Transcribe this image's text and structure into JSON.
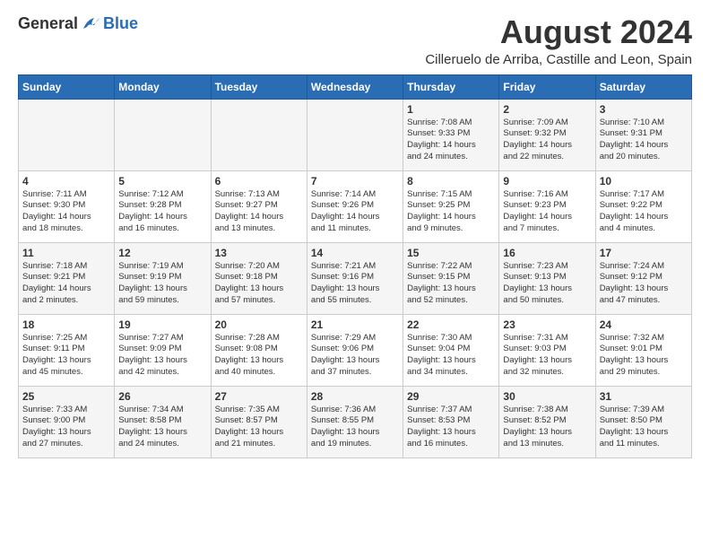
{
  "header": {
    "logo_general": "General",
    "logo_blue": "Blue",
    "month_title": "August 2024",
    "subtitle": "Cilleruelo de Arriba, Castille and Leon, Spain"
  },
  "weekdays": [
    "Sunday",
    "Monday",
    "Tuesday",
    "Wednesday",
    "Thursday",
    "Friday",
    "Saturday"
  ],
  "weeks": [
    [
      {
        "day": "",
        "info": ""
      },
      {
        "day": "",
        "info": ""
      },
      {
        "day": "",
        "info": ""
      },
      {
        "day": "",
        "info": ""
      },
      {
        "day": "1",
        "info": "Sunrise: 7:08 AM\nSunset: 9:33 PM\nDaylight: 14 hours\nand 24 minutes."
      },
      {
        "day": "2",
        "info": "Sunrise: 7:09 AM\nSunset: 9:32 PM\nDaylight: 14 hours\nand 22 minutes."
      },
      {
        "day": "3",
        "info": "Sunrise: 7:10 AM\nSunset: 9:31 PM\nDaylight: 14 hours\nand 20 minutes."
      }
    ],
    [
      {
        "day": "4",
        "info": "Sunrise: 7:11 AM\nSunset: 9:30 PM\nDaylight: 14 hours\nand 18 minutes."
      },
      {
        "day": "5",
        "info": "Sunrise: 7:12 AM\nSunset: 9:28 PM\nDaylight: 14 hours\nand 16 minutes."
      },
      {
        "day": "6",
        "info": "Sunrise: 7:13 AM\nSunset: 9:27 PM\nDaylight: 14 hours\nand 13 minutes."
      },
      {
        "day": "7",
        "info": "Sunrise: 7:14 AM\nSunset: 9:26 PM\nDaylight: 14 hours\nand 11 minutes."
      },
      {
        "day": "8",
        "info": "Sunrise: 7:15 AM\nSunset: 9:25 PM\nDaylight: 14 hours\nand 9 minutes."
      },
      {
        "day": "9",
        "info": "Sunrise: 7:16 AM\nSunset: 9:23 PM\nDaylight: 14 hours\nand 7 minutes."
      },
      {
        "day": "10",
        "info": "Sunrise: 7:17 AM\nSunset: 9:22 PM\nDaylight: 14 hours\nand 4 minutes."
      }
    ],
    [
      {
        "day": "11",
        "info": "Sunrise: 7:18 AM\nSunset: 9:21 PM\nDaylight: 14 hours\nand 2 minutes."
      },
      {
        "day": "12",
        "info": "Sunrise: 7:19 AM\nSunset: 9:19 PM\nDaylight: 13 hours\nand 59 minutes."
      },
      {
        "day": "13",
        "info": "Sunrise: 7:20 AM\nSunset: 9:18 PM\nDaylight: 13 hours\nand 57 minutes."
      },
      {
        "day": "14",
        "info": "Sunrise: 7:21 AM\nSunset: 9:16 PM\nDaylight: 13 hours\nand 55 minutes."
      },
      {
        "day": "15",
        "info": "Sunrise: 7:22 AM\nSunset: 9:15 PM\nDaylight: 13 hours\nand 52 minutes."
      },
      {
        "day": "16",
        "info": "Sunrise: 7:23 AM\nSunset: 9:13 PM\nDaylight: 13 hours\nand 50 minutes."
      },
      {
        "day": "17",
        "info": "Sunrise: 7:24 AM\nSunset: 9:12 PM\nDaylight: 13 hours\nand 47 minutes."
      }
    ],
    [
      {
        "day": "18",
        "info": "Sunrise: 7:25 AM\nSunset: 9:11 PM\nDaylight: 13 hours\nand 45 minutes."
      },
      {
        "day": "19",
        "info": "Sunrise: 7:27 AM\nSunset: 9:09 PM\nDaylight: 13 hours\nand 42 minutes."
      },
      {
        "day": "20",
        "info": "Sunrise: 7:28 AM\nSunset: 9:08 PM\nDaylight: 13 hours\nand 40 minutes."
      },
      {
        "day": "21",
        "info": "Sunrise: 7:29 AM\nSunset: 9:06 PM\nDaylight: 13 hours\nand 37 minutes."
      },
      {
        "day": "22",
        "info": "Sunrise: 7:30 AM\nSunset: 9:04 PM\nDaylight: 13 hours\nand 34 minutes."
      },
      {
        "day": "23",
        "info": "Sunrise: 7:31 AM\nSunset: 9:03 PM\nDaylight: 13 hours\nand 32 minutes."
      },
      {
        "day": "24",
        "info": "Sunrise: 7:32 AM\nSunset: 9:01 PM\nDaylight: 13 hours\nand 29 minutes."
      }
    ],
    [
      {
        "day": "25",
        "info": "Sunrise: 7:33 AM\nSunset: 9:00 PM\nDaylight: 13 hours\nand 27 minutes."
      },
      {
        "day": "26",
        "info": "Sunrise: 7:34 AM\nSunset: 8:58 PM\nDaylight: 13 hours\nand 24 minutes."
      },
      {
        "day": "27",
        "info": "Sunrise: 7:35 AM\nSunset: 8:57 PM\nDaylight: 13 hours\nand 21 minutes."
      },
      {
        "day": "28",
        "info": "Sunrise: 7:36 AM\nSunset: 8:55 PM\nDaylight: 13 hours\nand 19 minutes."
      },
      {
        "day": "29",
        "info": "Sunrise: 7:37 AM\nSunset: 8:53 PM\nDaylight: 13 hours\nand 16 minutes."
      },
      {
        "day": "30",
        "info": "Sunrise: 7:38 AM\nSunset: 8:52 PM\nDaylight: 13 hours\nand 13 minutes."
      },
      {
        "day": "31",
        "info": "Sunrise: 7:39 AM\nSunset: 8:50 PM\nDaylight: 13 hours\nand 11 minutes."
      }
    ]
  ]
}
